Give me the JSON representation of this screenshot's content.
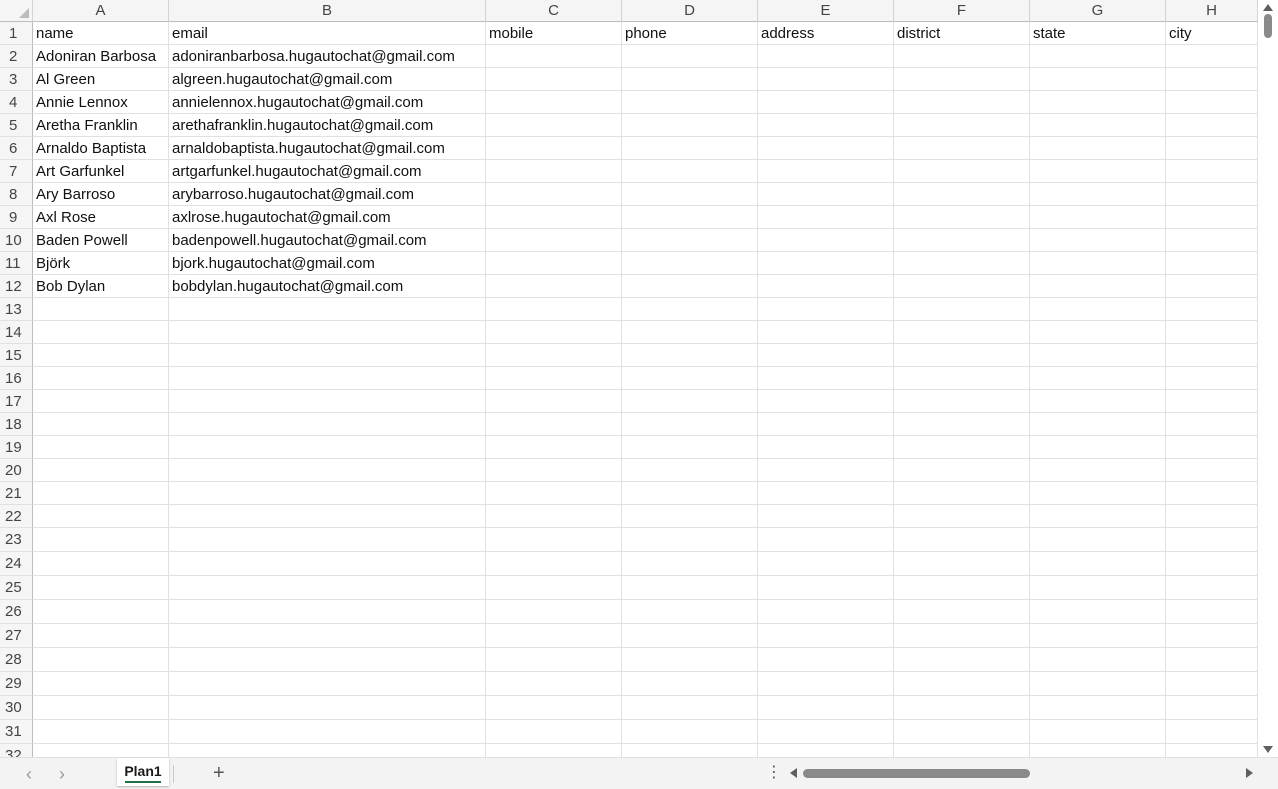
{
  "columns": [
    {
      "letter": "A"
    },
    {
      "letter": "B"
    },
    {
      "letter": "C"
    },
    {
      "letter": "D"
    },
    {
      "letter": "E"
    },
    {
      "letter": "F"
    },
    {
      "letter": "G"
    },
    {
      "letter": "H"
    }
  ],
  "rows": [
    {
      "num": "1",
      "cells": [
        "name",
        "email",
        "mobile",
        "phone",
        "address",
        "district",
        "state",
        "city"
      ]
    },
    {
      "num": "2",
      "cells": [
        "Adoniran Barbosa",
        "adoniranbarbosa.hugautochat@gmail.com",
        "",
        "",
        "",
        "",
        "",
        ""
      ]
    },
    {
      "num": "3",
      "cells": [
        "Al Green",
        "algreen.hugautochat@gmail.com",
        "",
        "",
        "",
        "",
        "",
        ""
      ]
    },
    {
      "num": "4",
      "cells": [
        "Annie Lennox",
        "annielennox.hugautochat@gmail.com",
        "",
        "",
        "",
        "",
        "",
        ""
      ]
    },
    {
      "num": "5",
      "cells": [
        "Aretha Franklin",
        "arethafranklin.hugautochat@gmail.com",
        "",
        "",
        "",
        "",
        "",
        ""
      ]
    },
    {
      "num": "6",
      "cells": [
        "Arnaldo Baptista",
        "arnaldobaptista.hugautochat@gmail.com",
        "",
        "",
        "",
        "",
        "",
        ""
      ]
    },
    {
      "num": "7",
      "cells": [
        "Art Garfunkel",
        "artgarfunkel.hugautochat@gmail.com",
        "",
        "",
        "",
        "",
        "",
        ""
      ]
    },
    {
      "num": "8",
      "cells": [
        "Ary Barroso",
        "arybarroso.hugautochat@gmail.com",
        "",
        "",
        "",
        "",
        "",
        ""
      ]
    },
    {
      "num": "9",
      "cells": [
        "Axl Rose",
        "axlrose.hugautochat@gmail.com",
        "",
        "",
        "",
        "",
        "",
        ""
      ]
    },
    {
      "num": "10",
      "cells": [
        "Baden Powell",
        "badenpowell.hugautochat@gmail.com",
        "",
        "",
        "",
        "",
        "",
        ""
      ]
    },
    {
      "num": "11",
      "cells": [
        "Björk",
        "bjork.hugautochat@gmail.com",
        "",
        "",
        "",
        "",
        "",
        ""
      ]
    },
    {
      "num": "12",
      "cells": [
        "Bob Dylan",
        "bobdylan.hugautochat@gmail.com",
        "",
        "",
        "",
        "",
        "",
        ""
      ]
    },
    {
      "num": "13",
      "cells": [
        "",
        "",
        "",
        "",
        "",
        "",
        "",
        ""
      ]
    },
    {
      "num": "14",
      "cells": [
        "",
        "",
        "",
        "",
        "",
        "",
        "",
        ""
      ]
    },
    {
      "num": "15",
      "cells": [
        "",
        "",
        "",
        "",
        "",
        "",
        "",
        ""
      ]
    },
    {
      "num": "16",
      "cells": [
        "",
        "",
        "",
        "",
        "",
        "",
        "",
        ""
      ]
    },
    {
      "num": "17",
      "cells": [
        "",
        "",
        "",
        "",
        "",
        "",
        "",
        ""
      ]
    },
    {
      "num": "18",
      "cells": [
        "",
        "",
        "",
        "",
        "",
        "",
        "",
        ""
      ]
    },
    {
      "num": "19",
      "cells": [
        "",
        "",
        "",
        "",
        "",
        "",
        "",
        ""
      ]
    },
    {
      "num": "20",
      "cells": [
        "",
        "",
        "",
        "",
        "",
        "",
        "",
        ""
      ]
    },
    {
      "num": "21",
      "cells": [
        "",
        "",
        "",
        "",
        "",
        "",
        "",
        ""
      ]
    },
    {
      "num": "22",
      "cells": [
        "",
        "",
        "",
        "",
        "",
        "",
        "",
        ""
      ]
    },
    {
      "num": "23",
      "cells": [
        "",
        "",
        "",
        "",
        "",
        "",
        "",
        ""
      ]
    },
    {
      "num": "24",
      "cells": [
        "",
        "",
        "",
        "",
        "",
        "",
        "",
        ""
      ]
    },
    {
      "num": "25",
      "cells": [
        "",
        "",
        "",
        "",
        "",
        "",
        "",
        ""
      ]
    },
    {
      "num": "26",
      "cells": [
        "",
        "",
        "",
        "",
        "",
        "",
        "",
        ""
      ]
    },
    {
      "num": "27",
      "cells": [
        "",
        "",
        "",
        "",
        "",
        "",
        "",
        ""
      ]
    },
    {
      "num": "28",
      "cells": [
        "",
        "",
        "",
        "",
        "",
        "",
        "",
        ""
      ]
    },
    {
      "num": "29",
      "cells": [
        "",
        "",
        "",
        "",
        "",
        "",
        "",
        ""
      ]
    },
    {
      "num": "30",
      "cells": [
        "",
        "",
        "",
        "",
        "",
        "",
        "",
        ""
      ]
    },
    {
      "num": "31",
      "cells": [
        "",
        "",
        "",
        "",
        "",
        "",
        "",
        ""
      ]
    },
    {
      "num": "32",
      "cells": [
        "",
        "",
        "",
        "",
        "",
        "",
        "",
        ""
      ]
    }
  ],
  "sheet_tabs": [
    {
      "label": "Plan1",
      "active": true
    }
  ],
  "controls": {
    "prev_sheet_icon": "chevron-left-icon",
    "next_sheet_icon": "chevron-right-icon",
    "add_sheet_label": "+",
    "more_label": "⋮"
  },
  "colors": {
    "active_tab_underline": "#1e7145",
    "header_bg": "#f5f5f5",
    "gridline": "#e1e1e1"
  }
}
